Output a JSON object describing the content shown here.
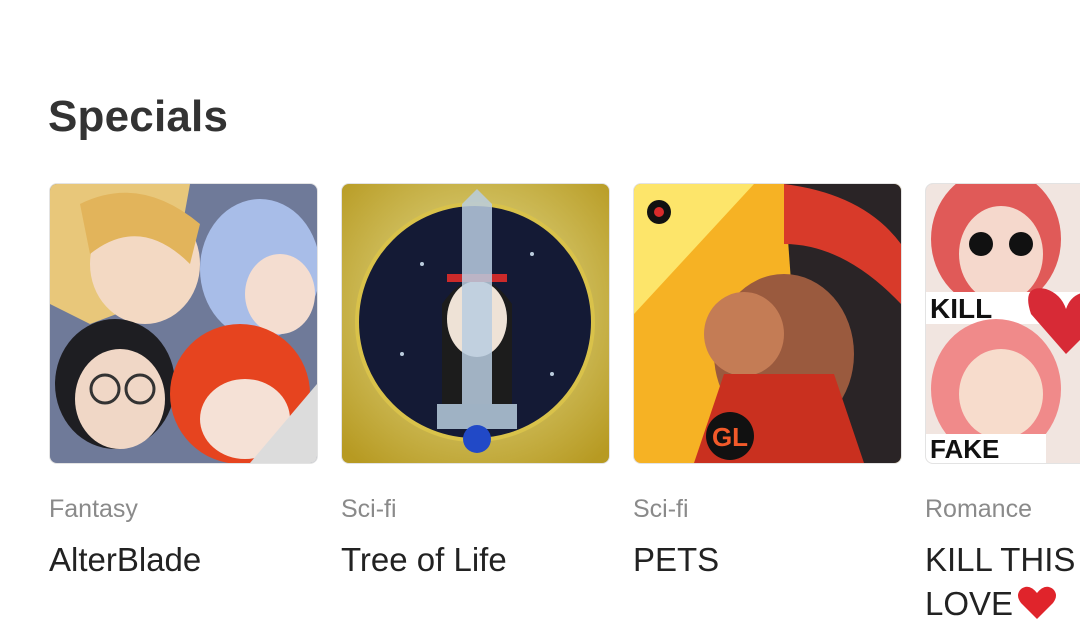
{
  "section": {
    "title": "Specials"
  },
  "cards": [
    {
      "genre": "Fantasy",
      "title": "AlterBlade"
    },
    {
      "genre": "Sci-fi",
      "title": "Tree of Life"
    },
    {
      "genre": "Sci-fi",
      "title": "PETS",
      "badge": "GL"
    },
    {
      "genre": "Romance",
      "title": "KILL THIS\nLOVE",
      "cover_text_top": "KILL",
      "cover_text_bottom": "FAKE",
      "emoji": "heart-icon"
    }
  ],
  "colors": {
    "heading": "#333333",
    "genre": "#8a8a8a",
    "title": "#222222",
    "heart": "#e0242b"
  }
}
